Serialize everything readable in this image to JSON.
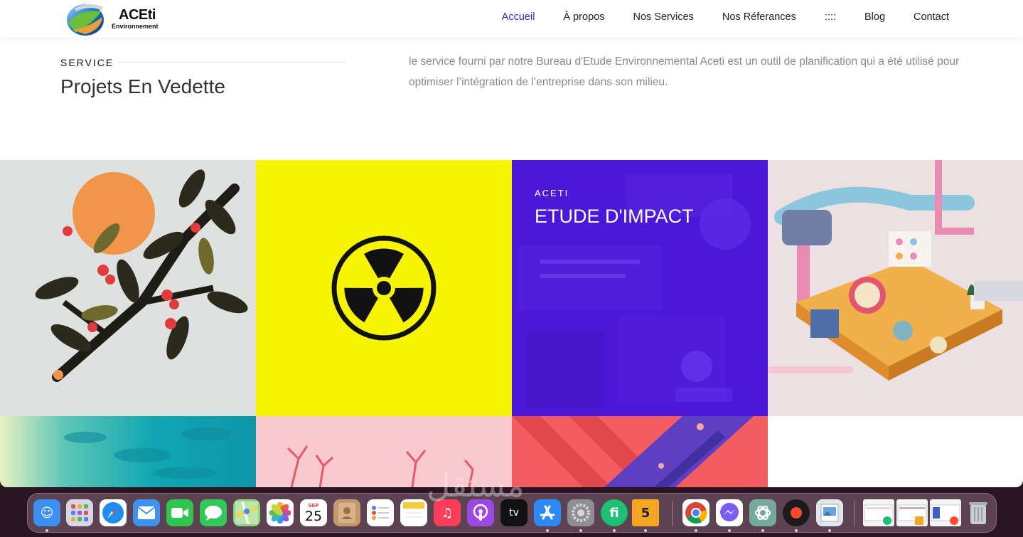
{
  "brand": {
    "name": "ACEti",
    "subtitle": "Environnement"
  },
  "nav": [
    {
      "label": "Accueil",
      "active": true
    },
    {
      "label": "À propos"
    },
    {
      "label": "Nos Services"
    },
    {
      "label": "Nos Réferances"
    },
    {
      "label": "::::"
    },
    {
      "label": "Blog"
    },
    {
      "label": "Contact"
    }
  ],
  "intro": {
    "kicker": "SERVICE",
    "title": "Projets En Vedette",
    "text": "le service fourni par notre Bureau d'Etude Environnemental Aceti est un outil de planification qui a été utilisé pour optimiser l’intégration de l’entreprise dans son milieu."
  },
  "featured": {
    "kicker": "ACETI",
    "title": "ETUDE D'IMPACT"
  },
  "colors": {
    "accent": "#3b1fc7",
    "yellow": "#f8f500",
    "purple": "#4b17d8",
    "teal": "#12b5b8",
    "pink": "#f8c9cf",
    "red": "#f35d62"
  },
  "dock": {
    "calendar_month": "SEP",
    "calendar_day": "25",
    "tv_label": "tv",
    "badge_five": "5",
    "watermark": "مستقل"
  }
}
